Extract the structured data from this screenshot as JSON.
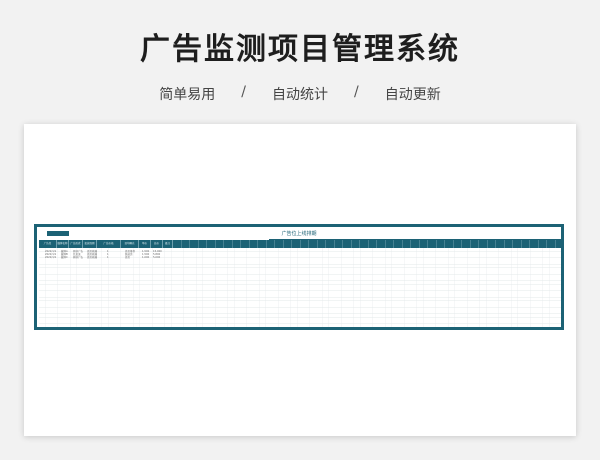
{
  "page": {
    "title": "广告监测项目管理系统",
    "features": [
      "简单易用",
      "自动统计",
      "自动更新"
    ],
    "separator": "/"
  },
  "sheet": {
    "title": "广告位上线排期",
    "accent_color": "#1c6275",
    "header_cells": [
      "广告位",
      "媒体名称",
      "广告形式",
      "投放周期",
      "广告价格",
      "日均曝光",
      "单价",
      "总价",
      "备注"
    ],
    "rows": [
      [
        "2022/1/1",
        "媒体A",
        "开屏广告",
        "首页轮播",
        "1",
        "首页推荐",
        "1,500",
        "15,000"
      ],
      [
        "2022/1/1",
        "媒体B",
        "信息流",
        "首页轮播",
        "1",
        "频道页",
        "1,500",
        "5,800"
      ],
      [
        "2022/1/1",
        "媒体C",
        "开屏广告",
        "首页轮播",
        "1",
        "首页",
        "1,000",
        "5,000"
      ]
    ]
  }
}
